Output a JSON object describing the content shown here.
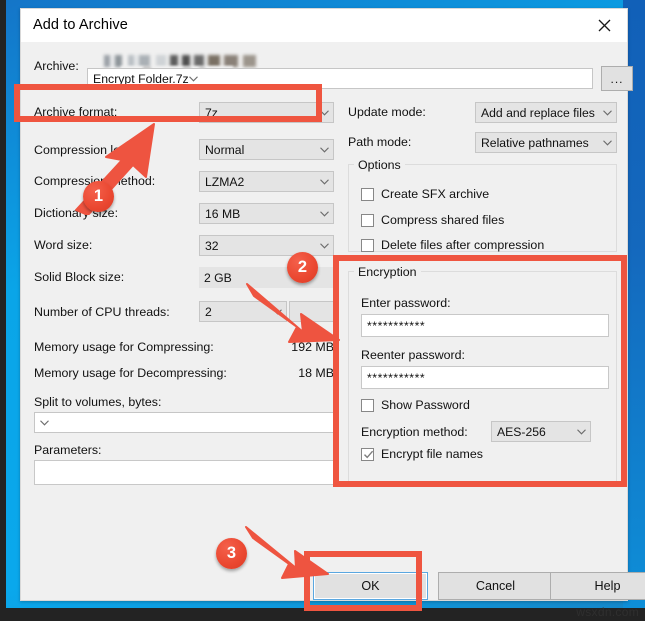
{
  "window": {
    "title": "Add to Archive",
    "close_icon": "close-icon"
  },
  "archive": {
    "label": "Archive:",
    "path_value": "Encrypt Folder.7z",
    "browse_label": "...",
    "redacted_path_note": ""
  },
  "left_column": {
    "archive_format": {
      "label": "Archive format:",
      "value": "7z"
    },
    "compression_level": {
      "label": "Compression level:",
      "value": "Normal"
    },
    "compression_method": {
      "label": "Compression method:",
      "value": "LZMA2"
    },
    "dictionary_size": {
      "label": "Dictionary size:",
      "value": "16 MB"
    },
    "word_size": {
      "label": "Word size:",
      "value": "32"
    },
    "solid_block_size": {
      "label": "Solid Block size:",
      "value": "2 GB"
    },
    "cpu_threads": {
      "label": "Number of CPU threads:",
      "value": "2"
    },
    "memory_compressing": {
      "label": "Memory usage for Compressing:",
      "value": "192 MB"
    },
    "memory_decompressing": {
      "label": "Memory usage for Decompressing:",
      "value": "18 MB"
    },
    "split_volumes": {
      "label": "Split to volumes, bytes:",
      "value": ""
    },
    "parameters": {
      "label": "Parameters:",
      "value": ""
    }
  },
  "right_column": {
    "update_mode": {
      "label": "Update mode:",
      "value": "Add and replace files"
    },
    "path_mode": {
      "label": "Path mode:",
      "value": "Relative pathnames"
    },
    "options": {
      "title": "Options",
      "items": [
        {
          "label": "Create SFX archive",
          "checked": false
        },
        {
          "label": "Compress shared files",
          "checked": false
        },
        {
          "label": "Delete files after compression",
          "checked": false
        }
      ]
    },
    "encryption": {
      "title": "Encryption",
      "enter_password_label": "Enter password:",
      "enter_password_value": "***********",
      "reenter_password_label": "Reenter password:",
      "reenter_password_value": "***********",
      "show_password": {
        "label": "Show Password",
        "checked": false
      },
      "encryption_method": {
        "label": "Encryption method:",
        "value": "AES-256"
      },
      "encrypt_file_names": {
        "label": "Encrypt file names",
        "checked": true
      }
    }
  },
  "buttons": {
    "ok": "OK",
    "cancel": "Cancel",
    "help": "Help"
  },
  "annotations": {
    "markers": [
      "1",
      "2",
      "3"
    ],
    "highlight_color": "#ef5540"
  },
  "watermark": "wsxdn.com"
}
